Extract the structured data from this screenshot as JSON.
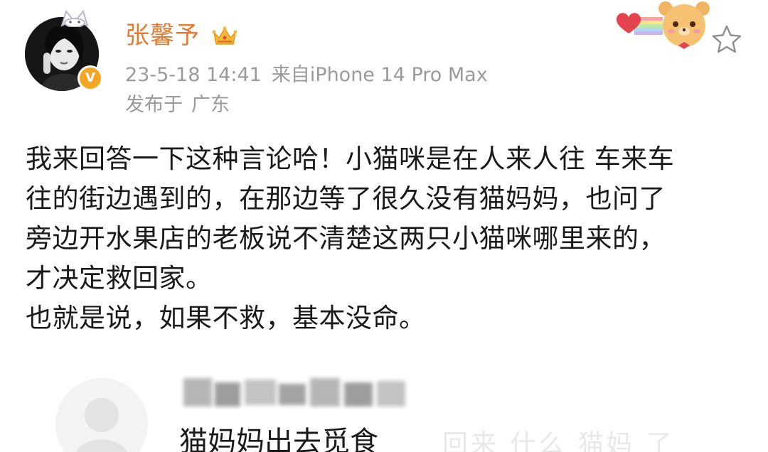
{
  "post": {
    "author": {
      "name": "张馨予",
      "verified_badge": "V"
    },
    "meta": {
      "timestamp": "23-5-18 14:41",
      "source": "来自iPhone 14 Pro Max",
      "location_prefix": "发布于",
      "location": "广东"
    },
    "body_lines": [
      "我来回答一下这种言论哈！小猫咪是在人来人往 车来车",
      "往的街边遇到的，在那边等了很久没有猫妈妈，也问了",
      "旁边开水果店的老板说不清楚这两只小猫咪哪里来的，",
      "才决定救回家。",
      "也就是说，如果不救，基本没命。"
    ]
  },
  "reply": {
    "text": "猫妈妈出去觅食",
    "watermark": "回来 什么 猫妈 了"
  },
  "icons": {
    "crown": "crown-icon",
    "star": "star-outline-icon",
    "decoration": "bear-heart-rainbow-icon",
    "verified": "verified-v-icon"
  },
  "colors": {
    "username": "#e8792f",
    "meta": "#9a9a9a",
    "body_text": "#1a1a1a",
    "verified_badge": "#f5a623"
  }
}
